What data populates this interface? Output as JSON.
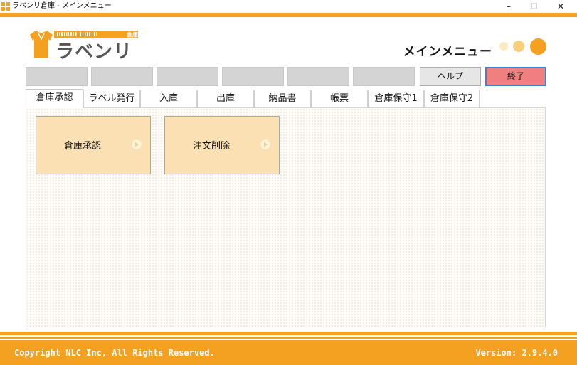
{
  "window": {
    "title": "ラベンリ倉庫 - メインメニュー",
    "minimize_glyph": "–",
    "maximize_glyph": "□",
    "close_glyph": "✕"
  },
  "header": {
    "logo_text": "ラベンリ",
    "logo_badge": "倉庫",
    "menu_title": "メインメニュー"
  },
  "toolbar": {
    "blank_buttons": [
      "",
      "",
      "",
      "",
      "",
      ""
    ],
    "help_label": "ヘルプ",
    "exit_label": "終了"
  },
  "tabs": [
    {
      "label": "倉庫承認",
      "active": true
    },
    {
      "label": "ラベル発行",
      "active": false
    },
    {
      "label": "入庫",
      "active": false
    },
    {
      "label": "出庫",
      "active": false
    },
    {
      "label": "納品書",
      "active": false
    },
    {
      "label": "帳票",
      "active": false
    },
    {
      "label": "倉庫保守1",
      "active": false
    },
    {
      "label": "倉庫保守2",
      "active": false
    }
  ],
  "tiles": [
    {
      "label": "倉庫承認",
      "icon": "play-arrow-icon"
    },
    {
      "label": "注文削除",
      "icon": "play-arrow-icon"
    }
  ],
  "footer": {
    "copyright": "Copyright NLC Inc, All Rights Reserved.",
    "version": "Version: 2.9.4.0"
  },
  "colors": {
    "accent": "#f4a020",
    "tile": "#fbe0b4",
    "exit": "#f08080"
  }
}
